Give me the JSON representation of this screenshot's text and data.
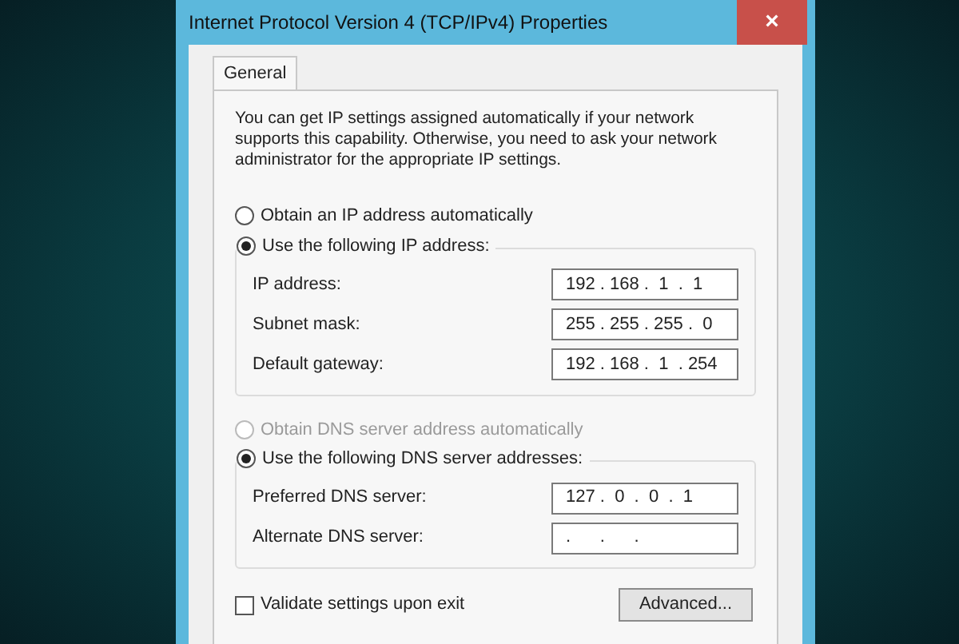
{
  "window": {
    "title": "Internet Protocol Version 4 (TCP/IPv4) Properties",
    "close": "×"
  },
  "tabs": [
    {
      "label": "General",
      "selected": true
    }
  ],
  "intro": "You can get IP settings assigned automatically if your network supports this capability. Otherwise, you need to ask your network administrator for the appropriate IP settings.",
  "ip_options": [
    {
      "label": "Obtain an IP address automatically",
      "selected": false,
      "disabled": false
    },
    {
      "label": "Use the following IP address:",
      "selected": true,
      "disabled": false
    }
  ],
  "ip_fields": [
    {
      "label": "IP address:",
      "value": "192 . 168 .  1  .  1"
    },
    {
      "label": "Subnet mask:",
      "value": "255 . 255 . 255 .  0"
    },
    {
      "label": "Default gateway:",
      "value": "192 . 168 .  1  . 254"
    }
  ],
  "dns_options": [
    {
      "label": "Obtain DNS server address automatically",
      "selected": false,
      "disabled": true
    },
    {
      "label": "Use the following DNS server addresses:",
      "selected": true,
      "disabled": false
    }
  ],
  "dns_fields": [
    {
      "label": "Preferred DNS server:",
      "value": "127 .  0  .  0  .  1"
    },
    {
      "label": "Alternate DNS server:",
      "value": ".      .      ."
    }
  ],
  "validate": {
    "label": "Validate settings upon exit",
    "checked": false
  },
  "advanced_button": "Advanced..."
}
